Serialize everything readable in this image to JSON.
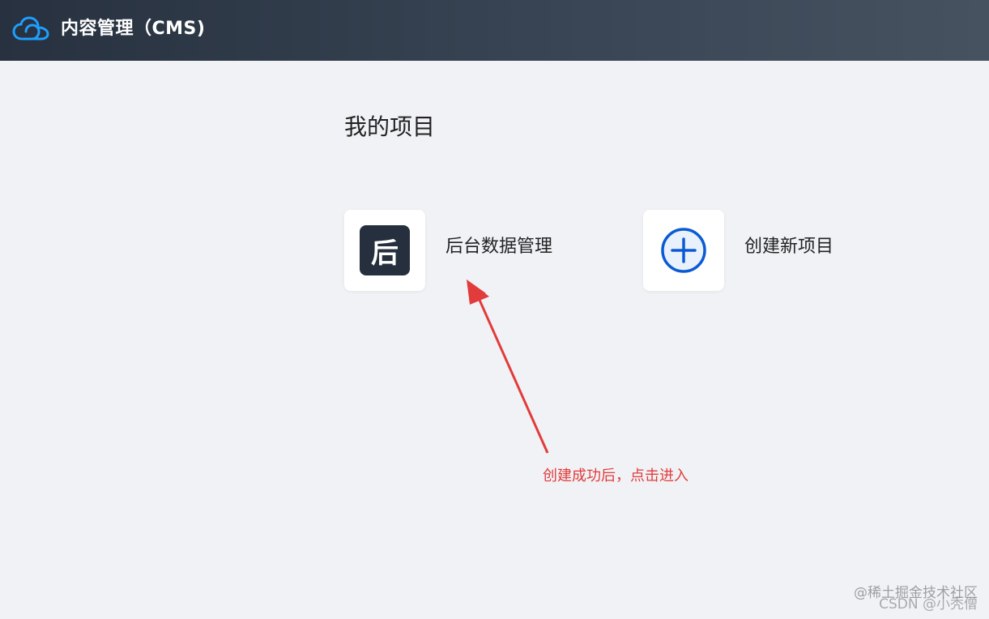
{
  "header": {
    "title": "内容管理（CMS)",
    "logo_icon": "cloud-icon",
    "logo_color": "#1e9fff"
  },
  "main": {
    "section_title": "我的项目",
    "projects": [
      {
        "avatar_text": "后",
        "label": "后台数据管理"
      }
    ],
    "new_project": {
      "icon": "plus-circle-icon",
      "label": "创建新项目",
      "icon_color": "#0a5bd3"
    }
  },
  "annotation": {
    "text": "创建成功后，点击进入",
    "color": "#e23b3b"
  },
  "watermark": {
    "line1": "@稀土掘金技术社区",
    "line2": "CSDN @小秃僧"
  }
}
